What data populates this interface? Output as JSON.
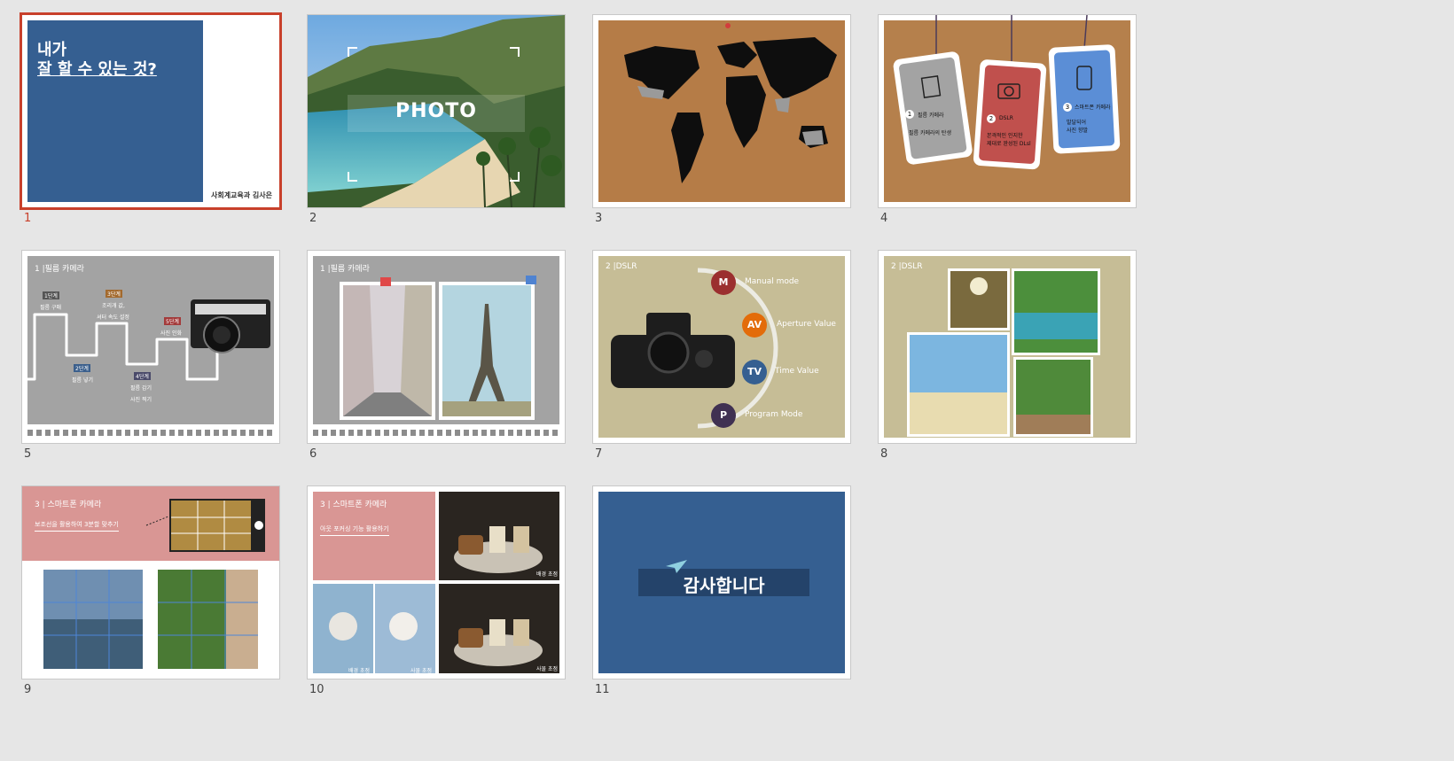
{
  "colors": {
    "selection": "#c8402b",
    "blue": "#355f91",
    "gray": "#a3a3a3",
    "khaki": "#c6bd96",
    "rose": "#d99694",
    "cork": "#b57c47"
  },
  "slides": [
    {
      "number": "1",
      "title_line1": "내가",
      "title_line2": "잘 할 수 있는 것?",
      "author": "사회계교육과 김사은"
    },
    {
      "number": "2",
      "label": "PHOTO"
    },
    {
      "number": "3"
    },
    {
      "number": "4",
      "tags": [
        {
          "num": "1",
          "title": "필름 카메라",
          "desc": "필름 카메라의 탄생"
        },
        {
          "num": "2",
          "title": "DSLR",
          "desc1": "본격적인 인지한",
          "desc2": "제대로 완성된 DLsl"
        },
        {
          "num": "3",
          "title": "스마트폰 카메라",
          "desc1": "발달되어",
          "desc2": "사진 향발"
        }
      ]
    },
    {
      "number": "5",
      "header": "1 |필름 카메라",
      "steps": [
        {
          "badge": "1단계",
          "text1": "필름 구매",
          "text2": ""
        },
        {
          "badge": "2단계",
          "text1": "필름 넣기",
          "text2": ""
        },
        {
          "badge": "3단계",
          "text1": "조리개 값,",
          "text2": "셔터 속도 설정"
        },
        {
          "badge": "4단계",
          "text1": "필름 감기",
          "text2": "사진 찍기"
        },
        {
          "badge": "5단계",
          "text1": "사진 인화",
          "text2": ""
        }
      ]
    },
    {
      "number": "6",
      "header": "1 |필름 카메라"
    },
    {
      "number": "7",
      "header": "2 |DSLR",
      "modes": [
        {
          "letter": "M",
          "label": "Manual mode"
        },
        {
          "letter": "AV",
          "label": "Aperture Value"
        },
        {
          "letter": "TV",
          "label": "Time Value"
        },
        {
          "letter": "P",
          "label": "Program Mode"
        }
      ]
    },
    {
      "number": "8",
      "header": "2 |DSLR"
    },
    {
      "number": "9",
      "header": "3 | 스마트폰 카메라",
      "subtitle": "보조선을 활용하여 3분할 맞추기"
    },
    {
      "number": "10",
      "header": "3 | 스마트폰 카메라",
      "subtitle": "아웃 포커싱 기능 활용하기",
      "captions": [
        "배경 초점",
        "배경 초점",
        "사물 초점",
        "사물 초점"
      ]
    },
    {
      "number": "11",
      "label": "감사합니다"
    }
  ]
}
